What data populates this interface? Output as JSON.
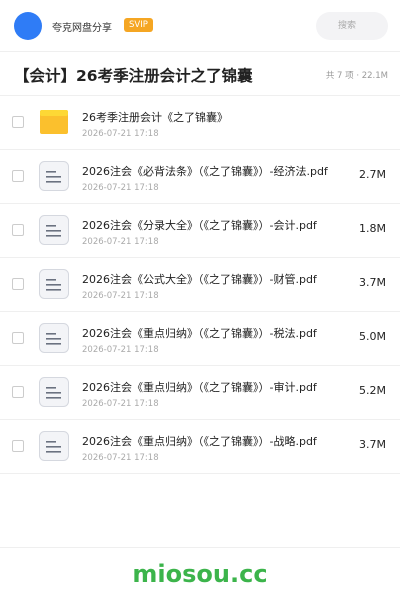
{
  "header": {
    "brand": "夸克网盘分享",
    "badge": "SVIP",
    "search_placeholder": "搜索"
  },
  "folder": {
    "title": "【会计】26考季注册会计之了锦囊",
    "meta": "共 7 项 · 22.1M"
  },
  "files": [
    {
      "type": "folder",
      "name": "26考季注册会计《之了锦囊》",
      "date": "2026-07-21 17:18",
      "size": ""
    },
    {
      "type": "doc",
      "name": "2026注会《必背法条》（《之了锦囊》）-经济法.pdf",
      "date": "2026-07-21 17:18",
      "size": "2.7M"
    },
    {
      "type": "doc",
      "name": "2026注会《分录大全》（《之了锦囊》）-会计.pdf",
      "date": "2026-07-21 17:18",
      "size": "1.8M"
    },
    {
      "type": "doc",
      "name": "2026注会《公式大全》（《之了锦囊》）-财管.pdf",
      "date": "2026-07-21 17:18",
      "size": "3.7M"
    },
    {
      "type": "doc",
      "name": "2026注会《重点归纳》（《之了锦囊》）-税法.pdf",
      "date": "2026-07-21 17:18",
      "size": "5.0M"
    },
    {
      "type": "doc",
      "name": "2026注会《重点归纳》（《之了锦囊》）-审计.pdf",
      "date": "2026-07-21 17:18",
      "size": "5.2M"
    },
    {
      "type": "doc",
      "name": "2026注会《重点归纳》（《之了锦囊》）-战略.pdf",
      "date": "2026-07-21 17:18",
      "size": "3.7M"
    }
  ],
  "watermark": "miosou.cc",
  "icons": {
    "folder": "folder-icon",
    "doc": "document-icon"
  },
  "colors": {
    "avatar": "#2f7cf6",
    "badge": "#f5a623",
    "folder_icon": "#fbc02d",
    "watermark": "#3cb44b"
  }
}
